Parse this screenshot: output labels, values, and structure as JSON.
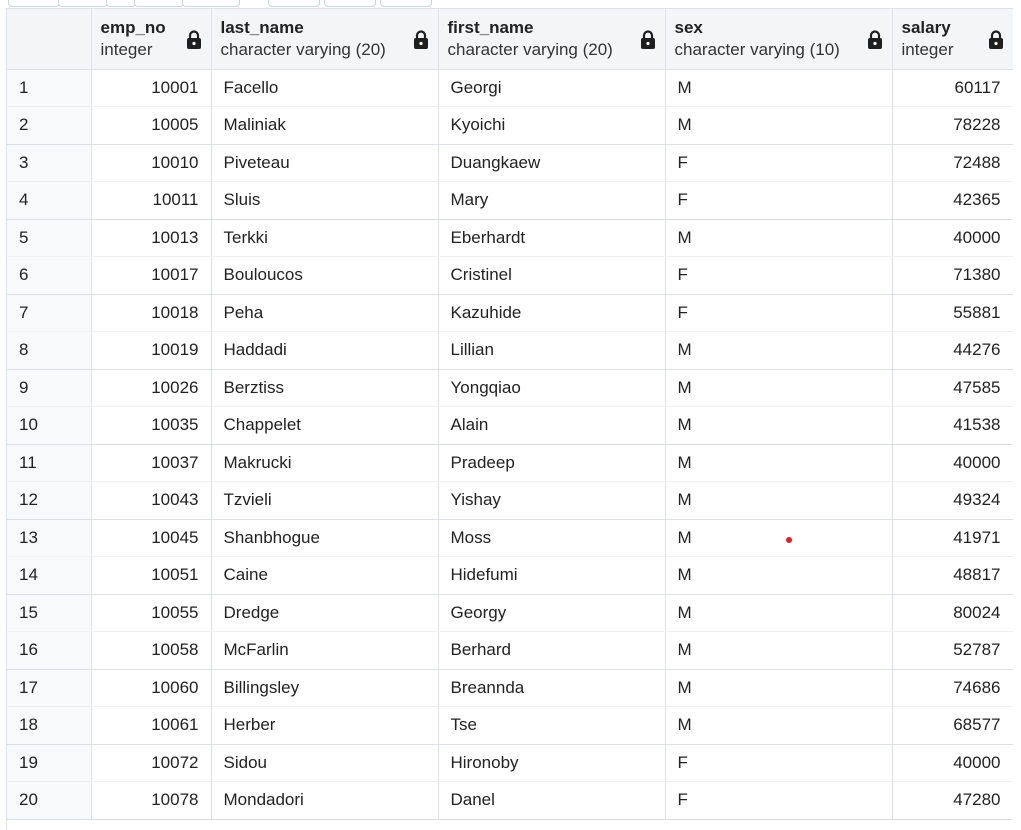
{
  "columns": [
    {
      "name": "emp_no",
      "type": "integer"
    },
    {
      "name": "last_name",
      "type": "character varying (20)"
    },
    {
      "name": "first_name",
      "type": "character varying (20)"
    },
    {
      "name": "sex",
      "type": "character varying (10)"
    },
    {
      "name": "salary",
      "type": "integer"
    }
  ],
  "icons": {
    "column_lock": "lock-icon"
  },
  "rows": [
    {
      "idx": "1",
      "emp_no": "10001",
      "last_name": "Facello",
      "first_name": "Georgi",
      "sex": "M",
      "salary": "60117"
    },
    {
      "idx": "2",
      "emp_no": "10005",
      "last_name": "Maliniak",
      "first_name": "Kyoichi",
      "sex": "M",
      "salary": "78228"
    },
    {
      "idx": "3",
      "emp_no": "10010",
      "last_name": "Piveteau",
      "first_name": "Duangkaew",
      "sex": "F",
      "salary": "72488"
    },
    {
      "idx": "4",
      "emp_no": "10011",
      "last_name": "Sluis",
      "first_name": "Mary",
      "sex": "F",
      "salary": "42365"
    },
    {
      "idx": "5",
      "emp_no": "10013",
      "last_name": "Terkki",
      "first_name": "Eberhardt",
      "sex": "M",
      "salary": "40000"
    },
    {
      "idx": "6",
      "emp_no": "10017",
      "last_name": "Bouloucos",
      "first_name": "Cristinel",
      "sex": "F",
      "salary": "71380"
    },
    {
      "idx": "7",
      "emp_no": "10018",
      "last_name": "Peha",
      "first_name": "Kazuhide",
      "sex": "F",
      "salary": "55881"
    },
    {
      "idx": "8",
      "emp_no": "10019",
      "last_name": "Haddadi",
      "first_name": "Lillian",
      "sex": "M",
      "salary": "44276"
    },
    {
      "idx": "9",
      "emp_no": "10026",
      "last_name": "Berztiss",
      "first_name": "Yongqiao",
      "sex": "M",
      "salary": "47585"
    },
    {
      "idx": "10",
      "emp_no": "10035",
      "last_name": "Chappelet",
      "first_name": "Alain",
      "sex": "M",
      "salary": "41538"
    },
    {
      "idx": "11",
      "emp_no": "10037",
      "last_name": "Makrucki",
      "first_name": "Pradeep",
      "sex": "M",
      "salary": "40000"
    },
    {
      "idx": "12",
      "emp_no": "10043",
      "last_name": "Tzvieli",
      "first_name": "Yishay",
      "sex": "M",
      "salary": "49324"
    },
    {
      "idx": "13",
      "emp_no": "10045",
      "last_name": "Shanbhogue",
      "first_name": "Moss",
      "sex": "M",
      "salary": "41971"
    },
    {
      "idx": "14",
      "emp_no": "10051",
      "last_name": "Caine",
      "first_name": "Hidefumi",
      "sex": "M",
      "salary": "48817"
    },
    {
      "idx": "15",
      "emp_no": "10055",
      "last_name": "Dredge",
      "first_name": "Georgy",
      "sex": "M",
      "salary": "80024"
    },
    {
      "idx": "16",
      "emp_no": "10058",
      "last_name": "McFarlin",
      "first_name": "Berhard",
      "sex": "M",
      "salary": "52787"
    },
    {
      "idx": "17",
      "emp_no": "10060",
      "last_name": "Billingsley",
      "first_name": "Breannda",
      "sex": "M",
      "salary": "74686"
    },
    {
      "idx": "18",
      "emp_no": "10061",
      "last_name": "Herber",
      "first_name": "Tse",
      "sex": "M",
      "salary": "68577"
    },
    {
      "idx": "19",
      "emp_no": "10072",
      "last_name": "Sidou",
      "first_name": "Hironoby",
      "sex": "F",
      "salary": "40000"
    },
    {
      "idx": "20",
      "emp_no": "10078",
      "last_name": "Mondadori",
      "first_name": "Danel",
      "sex": "F",
      "salary": "47280"
    }
  ]
}
